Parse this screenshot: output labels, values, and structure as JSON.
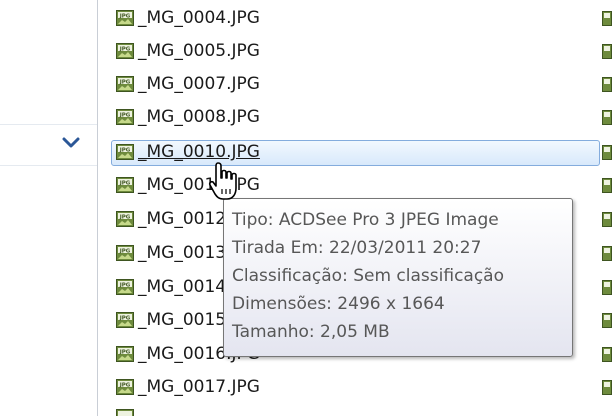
{
  "files": [
    {
      "name": "_MG_0004.JPG",
      "selected": false
    },
    {
      "name": "_MG_0005.JPG",
      "selected": false
    },
    {
      "name": "_MG_0007.JPG",
      "selected": false
    },
    {
      "name": "_MG_0008.JPG",
      "selected": false
    },
    {
      "name": "_MG_0010.JPG",
      "selected": true
    },
    {
      "name": "_MG_0011.JPG",
      "selected": false
    },
    {
      "name": "_MG_0012.JPG",
      "selected": false
    },
    {
      "name": "_MG_0013.JPG",
      "selected": false
    },
    {
      "name": "_MG_0014.JPG",
      "selected": false
    },
    {
      "name": "_MG_0015.JPG",
      "selected": false
    },
    {
      "name": "_MG_0016.JPG",
      "selected": false
    },
    {
      "name": "_MG_0017.JPG",
      "selected": false
    }
  ],
  "tooltip": {
    "type_line": "Tipo: ACDSee Pro 3 JPEG Image",
    "date_line": "Tirada Em: 22/03/2011 20:27",
    "rating_line": "Classificação: Sem classificação",
    "dimensions_line": "Dimensões: 2496 x 1664",
    "size_line": "Tamanho: 2,05 MB"
  },
  "icons": {
    "file_icon": "jpg-file-icon",
    "expand_icon": "chevron-down-icon",
    "cursor_icon": "hand-pointer-icon"
  },
  "colors": {
    "selection_border": "#84acdd",
    "selection_fill": "#d8e9fb",
    "chevron": "#2b5797",
    "tooltip_text": "#575757"
  }
}
